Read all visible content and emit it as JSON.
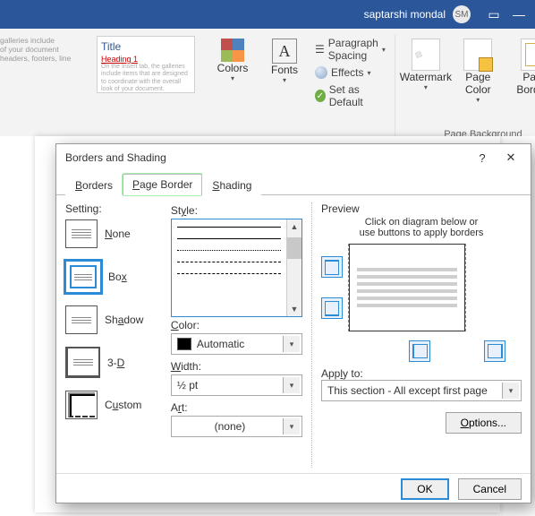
{
  "titlebar": {
    "user_name": "saptarshi mondal",
    "user_initials": "SM"
  },
  "ribbon": {
    "styles": {
      "card_title": "Title",
      "card_heading": "Heading 1",
      "gallery_hint1": "galleries include",
      "gallery_hint2": "of your document",
      "gallery_hint3": "headers, footers, line"
    },
    "colors_label": "Colors",
    "fonts_label": "Fonts",
    "spacing_label": "Paragraph Spacing",
    "effects_label": "Effects",
    "default_label": "Set as Default",
    "watermark_label": "Watermark",
    "pagecolor_label": "Page Color",
    "pageborders_label": "Page Borders",
    "group_pgbg": "Page Background"
  },
  "dialog": {
    "title": "Borders and Shading",
    "tabs": {
      "borders": "Borders",
      "page_border": "Page Border",
      "shading": "Shading"
    },
    "setting_label": "Setting:",
    "setting": {
      "none": "None",
      "box": "Box",
      "shadow": "Shadow",
      "threeD": "3-D",
      "custom": "Custom"
    },
    "style_label": "Style:",
    "color_label": "Color:",
    "color_value": "Automatic",
    "width_label": "Width:",
    "width_value": "½ pt",
    "art_label": "Art:",
    "art_value": "(none)",
    "preview_label": "Preview",
    "preview_hint1": "Click on diagram below or",
    "preview_hint2": "use buttons to apply borders",
    "apply_label": "Apply to:",
    "apply_value": "This section - All except first page",
    "options_btn": "Options...",
    "ok_btn": "OK",
    "cancel_btn": "Cancel"
  }
}
